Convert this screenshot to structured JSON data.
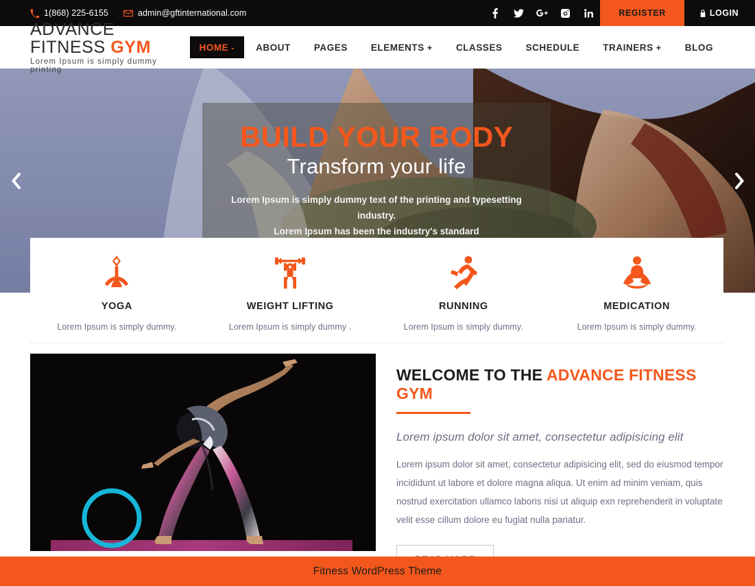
{
  "topbar": {
    "phone": "1(868) 225-6155",
    "email": "admin@gftinternational.com",
    "phone_icon": "phone-icon",
    "email_icon": "envelope-icon",
    "social": [
      {
        "name": "facebook-icon",
        "label": "f"
      },
      {
        "name": "twitter-icon",
        "label": "t"
      },
      {
        "name": "google-plus-icon",
        "label": "G+"
      },
      {
        "name": "instagram-icon",
        "label": "ig"
      },
      {
        "name": "linkedin-icon",
        "label": "in"
      }
    ],
    "register_label": "REGISTER",
    "login_label": "LOGIN",
    "login_icon": "lock-icon",
    "bg_color": "#0d0b0b",
    "accent_color": "#f4571c"
  },
  "header": {
    "logo_main": "ADVANCE FITNESS",
    "logo_accent": "GYM",
    "logo_tagline": "Lorem Ipsum is simply dummy printing",
    "nav": [
      {
        "label": "HOME",
        "caret": "-",
        "active": true
      },
      {
        "label": "ABOUT",
        "caret": "",
        "active": false
      },
      {
        "label": "PAGES",
        "caret": "",
        "active": false
      },
      {
        "label": "ELEMENTS",
        "caret": "+",
        "active": false
      },
      {
        "label": "CLASSES",
        "caret": "",
        "active": false
      },
      {
        "label": "SCHEDULE",
        "caret": "",
        "active": false
      },
      {
        "label": "TRAINERS",
        "caret": "+",
        "active": false
      },
      {
        "label": "BLOG",
        "caret": "",
        "active": false
      }
    ]
  },
  "hero": {
    "title": "BUILD YOUR BODY",
    "subtitle": "Transform your life",
    "desc_line1": "Lorem Ipsum is simply dummy text of the printing and typesetting industry.",
    "desc_line2": "Lorem Ipsum has been the industry's standard",
    "prev_icon": "chevron-left-icon",
    "next_icon": "chevron-right-icon",
    "title_color": "#f4571c"
  },
  "services": [
    {
      "icon": "yoga-standing-icon",
      "title": "YOGA",
      "desc": "Lorem Ipsum is simply dummy."
    },
    {
      "icon": "weight-lifting-icon",
      "title": "WEIGHT LIFTING",
      "desc": "Lorem Ipsum is simply dummy ."
    },
    {
      "icon": "running-icon",
      "title": "RUNNING",
      "desc": "Lorem Ipsum is simply dummy."
    },
    {
      "icon": "meditation-icon",
      "title": "MEDICATION",
      "desc": "Lorem Ipsum is simply dummy."
    }
  ],
  "welcome": {
    "heading_plain": "WELCOME TO THE ",
    "heading_accent": "ADVANCE FITNESS GYM",
    "lead": "Lorem ipsum dolor sit amet, consectetur adipisicing elit",
    "body": "Lorem ipsum dolor sit amet, consectetur adipisicing elit, sed do eiusmod tempor incididunt ut labore et dolore magna aliqua. Ut enim ad minim veniam, quis nostrud exercitation ullamco laboris nisi ut aliquip exn reprehenderit in voluptate velit esse cillum dolore eu fugiat nulla pariatur.",
    "read_more_label": "READ MORE",
    "photo_name": "yoga-pose-photo"
  },
  "footer": {
    "text": "Fitness WordPress Theme",
    "bg_color": "#f4571c"
  }
}
